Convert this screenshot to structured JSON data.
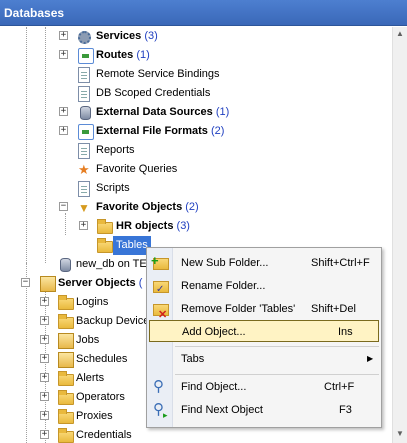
{
  "panel": {
    "title": "Databases"
  },
  "tree": {
    "services": {
      "label": "Services",
      "count": "(3)"
    },
    "routes": {
      "label": "Routes",
      "count": "(1)"
    },
    "remote_bindings": {
      "label": "Remote Service Bindings"
    },
    "db_scoped": {
      "label": "DB Scoped Credentials"
    },
    "ext_sources": {
      "label": "External Data Sources",
      "count": "(1)"
    },
    "ext_formats": {
      "label": "External File Formats",
      "count": "(2)"
    },
    "reports": {
      "label": "Reports"
    },
    "fav_queries": {
      "label": "Favorite Queries"
    },
    "scripts": {
      "label": "Scripts"
    },
    "fav_objects": {
      "label": "Favorite Objects",
      "count": "(2)"
    },
    "hr_objects": {
      "label": "HR objects",
      "count": "(3)"
    },
    "tables": {
      "label": "Tables"
    },
    "new_db": {
      "label": "new_db on TE"
    },
    "server_objects": {
      "label": "Server Objects",
      "count": "("
    },
    "logins": {
      "label": "Logins"
    },
    "backup_devices": {
      "label": "Backup Device"
    },
    "jobs": {
      "label": "Jobs"
    },
    "schedules": {
      "label": "Schedules"
    },
    "alerts": {
      "label": "Alerts"
    },
    "operators": {
      "label": "Operators"
    },
    "proxies": {
      "label": "Proxies"
    },
    "credentials": {
      "label": "Credentials"
    }
  },
  "context_menu": {
    "new_sub_folder": {
      "label": "New Sub Folder...",
      "shortcut": "Shift+Ctrl+F"
    },
    "rename_folder": {
      "label": "Rename Folder..."
    },
    "remove_folder": {
      "label": "Remove Folder 'Tables'",
      "shortcut": "Shift+Del"
    },
    "add_object": {
      "label": "Add Object...",
      "shortcut": "Ins"
    },
    "tabs": {
      "label": "Tabs",
      "arrow": "▶"
    },
    "find_object": {
      "label": "Find Object...",
      "shortcut": "Ctrl+F"
    },
    "find_next": {
      "label": "Find Next Object",
      "shortcut": "F3"
    }
  },
  "colors": {
    "title_bar": "#3a68b8",
    "selection": "#3875d7",
    "count_text": "#1f3fc0",
    "menu_highlight": "#fff3c4"
  }
}
